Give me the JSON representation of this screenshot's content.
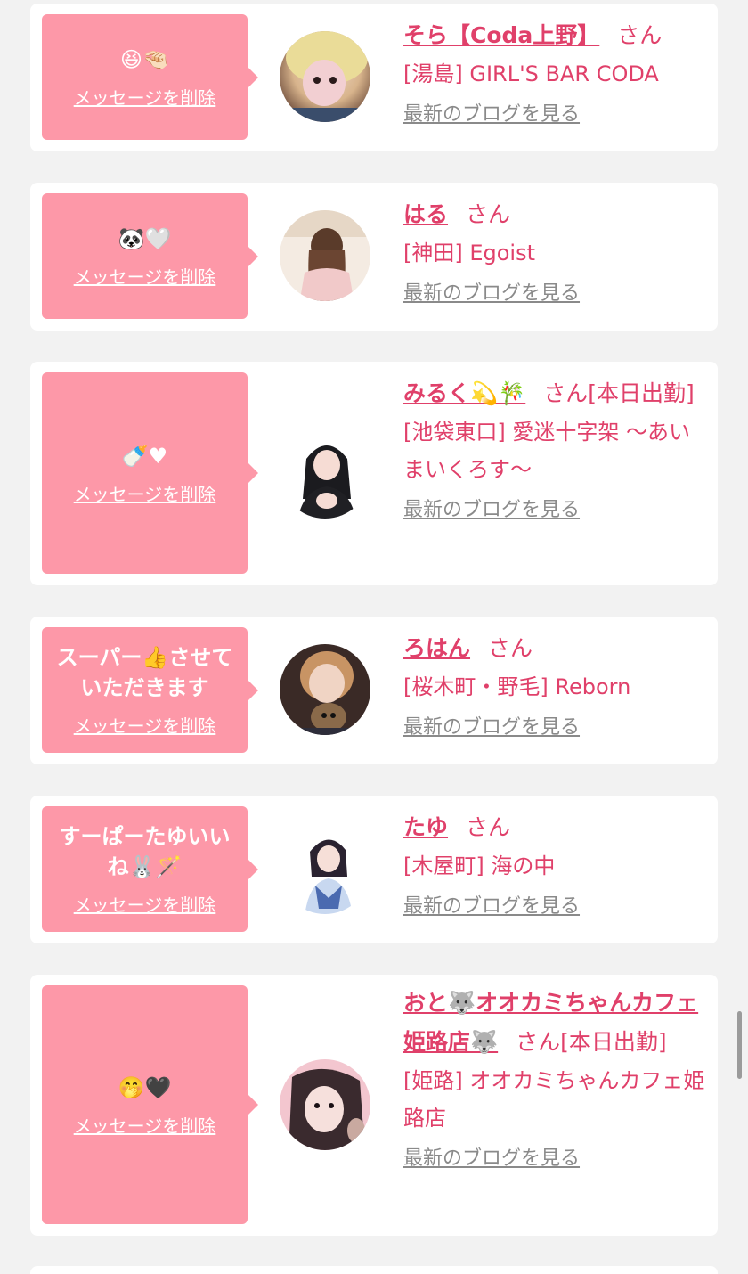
{
  "delete_label": "メッセージを削除",
  "blog_label": "最新のブログを見る",
  "san_label": "さん",
  "colors": {
    "accent": "#e0406a",
    "bubble": "#fd98a8",
    "muted_link": "#8a8a8a",
    "background": "#f2f2f2"
  },
  "cards": [
    {
      "message": "😆🤏🏻",
      "name": "そら【Coda上野】",
      "badge": "",
      "shop": "[湯島] GIRL'S BAR CODA"
    },
    {
      "message": "🐼🤍",
      "name": "はる",
      "badge": "",
      "shop": "[神田] Egoist"
    },
    {
      "message": "🍼♥",
      "name": "みるく💫🎋",
      "badge": "[本日出勤]",
      "shop": "[池袋東口] 愛迷十字架 〜あいまいくろす〜"
    },
    {
      "message": "スーパー👍させていただきます",
      "name": "ろはん",
      "badge": "",
      "shop": "[桜木町・野毛] Reborn"
    },
    {
      "message": "すーぱーたゆいいね🐰🪄",
      "name": "たゆ",
      "badge": "",
      "shop": "[木屋町] 海の中"
    },
    {
      "message": "🤭🖤",
      "name": "おと🐺オオカミちゃんカフェ姫路店🐺",
      "badge": "[本日出勤]",
      "shop": "[姫路] オオカミちゃんカフェ姫路店"
    }
  ]
}
